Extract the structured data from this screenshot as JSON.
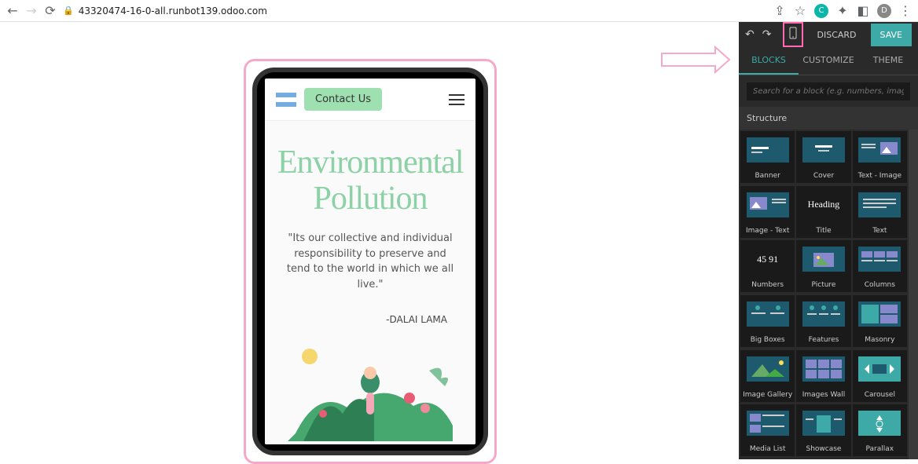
{
  "browser": {
    "url": "43320474-16-0-all.runbot139.odoo.com"
  },
  "editor": {
    "discard": "DISCARD",
    "save": "SAVE",
    "tabs": {
      "blocks": "BLOCKS",
      "customize": "CUSTOMIZE",
      "theme": "THEME"
    },
    "search_placeholder": "Search for a block (e.g. numbers, image wall, ...)",
    "section": "Structure",
    "blocks": [
      {
        "label": "Banner"
      },
      {
        "label": "Cover"
      },
      {
        "label": "Text - Image"
      },
      {
        "label": "Image - Text"
      },
      {
        "label": "Title"
      },
      {
        "label": "Text"
      },
      {
        "label": "Numbers"
      },
      {
        "label": "Picture"
      },
      {
        "label": "Columns"
      },
      {
        "label": "Big Boxes"
      },
      {
        "label": "Features"
      },
      {
        "label": "Masonry"
      },
      {
        "label": "Image Gallery"
      },
      {
        "label": "Images Wall"
      },
      {
        "label": "Carousel"
      },
      {
        "label": "Media List"
      },
      {
        "label": "Showcase"
      },
      {
        "label": "Parallax"
      }
    ]
  },
  "phone": {
    "contact_btn": "Contact Us",
    "heading": "Environmental Pollution",
    "quote": "\"Its our collective and individual responsibility to preserve and tend to the world in which we all live.\"",
    "author": "-DALAI LAMA"
  }
}
